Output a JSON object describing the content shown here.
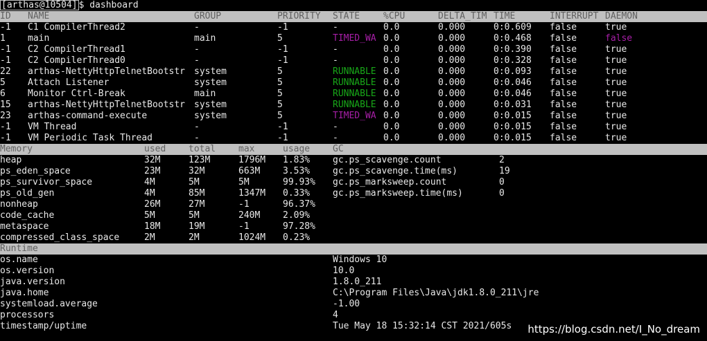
{
  "prompt": "[arthas@10504]$ dashboard",
  "thread_header": [
    "ID",
    "NAME",
    "GROUP",
    "PRIORITY",
    "STATE",
    "%CPU",
    "DELTA_TIM",
    "TIME",
    "INTERRUPT",
    "DAEMON"
  ],
  "threads": [
    {
      "id": "-1",
      "name": "C1 CompilerThread2",
      "group": "-",
      "priority": "-1",
      "state": "-",
      "cpu": "0.0",
      "delta": "0.000",
      "time": "0:0.609",
      "interrupt": "false",
      "daemon": "true"
    },
    {
      "id": "1",
      "name": "main",
      "group": "main",
      "priority": "5",
      "state": "TIMED_WA",
      "cpu": "0.0",
      "delta": "0.000",
      "time": "0:0.468",
      "interrupt": "false",
      "daemon": "false"
    },
    {
      "id": "-1",
      "name": "C2 CompilerThread1",
      "group": "-",
      "priority": "-1",
      "state": "-",
      "cpu": "0.0",
      "delta": "0.000",
      "time": "0:0.390",
      "interrupt": "false",
      "daemon": "true"
    },
    {
      "id": "-1",
      "name": "C2 CompilerThread0",
      "group": "-",
      "priority": "-1",
      "state": "-",
      "cpu": "0.0",
      "delta": "0.000",
      "time": "0:0.328",
      "interrupt": "false",
      "daemon": "true"
    },
    {
      "id": "22",
      "name": "arthas-NettyHttpTelnetBootstr",
      "group": "system",
      "priority": "5",
      "state": "RUNNABLE",
      "cpu": "0.0",
      "delta": "0.000",
      "time": "0:0.093",
      "interrupt": "false",
      "daemon": "true"
    },
    {
      "id": "5",
      "name": "Attach Listener",
      "group": "system",
      "priority": "5",
      "state": "RUNNABLE",
      "cpu": "0.0",
      "delta": "0.000",
      "time": "0:0.046",
      "interrupt": "false",
      "daemon": "true"
    },
    {
      "id": "6",
      "name": "Monitor Ctrl-Break",
      "group": "main",
      "priority": "5",
      "state": "RUNNABLE",
      "cpu": "0.0",
      "delta": "0.000",
      "time": "0:0.046",
      "interrupt": "false",
      "daemon": "true"
    },
    {
      "id": "15",
      "name": "arthas-NettyHttpTelnetBootstr",
      "group": "system",
      "priority": "5",
      "state": "RUNNABLE",
      "cpu": "0.0",
      "delta": "0.000",
      "time": "0:0.031",
      "interrupt": "false",
      "daemon": "true"
    },
    {
      "id": "23",
      "name": "arthas-command-execute",
      "group": "system",
      "priority": "5",
      "state": "TIMED_WA",
      "cpu": "0.0",
      "delta": "0.000",
      "time": "0:0.015",
      "interrupt": "false",
      "daemon": "true"
    },
    {
      "id": "-1",
      "name": "VM Thread",
      "group": "-",
      "priority": "-1",
      "state": "-",
      "cpu": "0.0",
      "delta": "0.000",
      "time": "0:0.015",
      "interrupt": "false",
      "daemon": "true"
    },
    {
      "id": "-1",
      "name": "VM Periodic Task Thread",
      "group": "-",
      "priority": "-1",
      "state": "-",
      "cpu": "0.0",
      "delta": "0.000",
      "time": "0:0.015",
      "interrupt": "false",
      "daemon": "true"
    }
  ],
  "memory_header": [
    "Memory",
    "used",
    "total",
    "max",
    "usage",
    "GC"
  ],
  "memory": [
    {
      "name": "heap",
      "used": "32M",
      "total": "123M",
      "max": "1796M",
      "usage": "1.83%"
    },
    {
      "name": "ps_eden_space",
      "used": "23M",
      "total": "32M",
      "max": "663M",
      "usage": "3.53%"
    },
    {
      "name": "ps_survivor_space",
      "used": "4M",
      "total": "5M",
      "max": "5M",
      "usage": "99.93%"
    },
    {
      "name": "ps_old_gen",
      "used": "4M",
      "total": "85M",
      "max": "1347M",
      "usage": "0.33%"
    },
    {
      "name": "nonheap",
      "used": "26M",
      "total": "27M",
      "max": "-1",
      "usage": "96.37%"
    },
    {
      "name": "code_cache",
      "used": "5M",
      "total": "5M",
      "max": "240M",
      "usage": "2.09%"
    },
    {
      "name": "metaspace",
      "used": "18M",
      "total": "19M",
      "max": "-1",
      "usage": "97.28%"
    },
    {
      "name": "compressed_class_space",
      "used": "2M",
      "total": "2M",
      "max": "1024M",
      "usage": "0.23%"
    }
  ],
  "gc": [
    {
      "name": "gc.ps_scavenge.count",
      "value": "2"
    },
    {
      "name": "gc.ps_scavenge.time(ms)",
      "value": "19"
    },
    {
      "name": "gc.ps_marksweep.count",
      "value": "0"
    },
    {
      "name": "gc.ps_marksweep.time(ms)",
      "value": "0"
    }
  ],
  "runtime_header": "Runtime",
  "runtime": [
    {
      "key": "os.name",
      "value": "Windows 10"
    },
    {
      "key": "os.version",
      "value": "10.0"
    },
    {
      "key": "java.version",
      "value": "1.8.0_211"
    },
    {
      "key": "java.home",
      "value": "C:\\Program Files\\Java\\jdk1.8.0_211\\jre"
    },
    {
      "key": "systemload.average",
      "value": "-1.00"
    },
    {
      "key": "processors",
      "value": "4"
    },
    {
      "key": "timestamp/uptime",
      "value": "Tue May 18 15:32:14 CST 2021/605s"
    }
  ],
  "watermark": "https://blog.csdn.net/I_No_dream",
  "colors": {
    "background": "#000000",
    "text": "#c0c0c0",
    "header_bg": "#c0c0c0",
    "header_text": "#606060",
    "timed_waiting": "#a81fa8",
    "runnable": "#18a818",
    "daemon_false": "#a81fa8"
  }
}
